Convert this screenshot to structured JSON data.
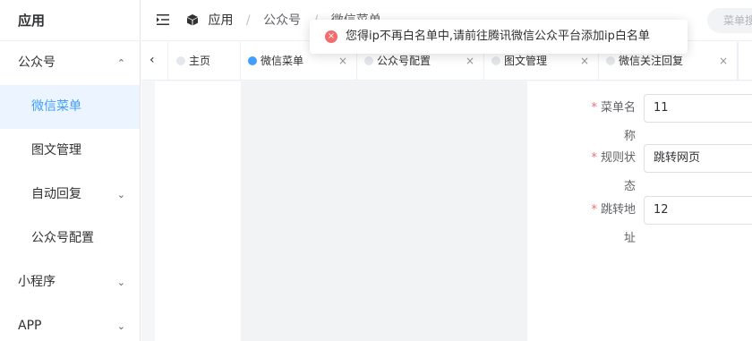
{
  "app": {
    "name": "应用"
  },
  "sidebar": {
    "items": [
      {
        "label": "公众号",
        "has_arrow": true,
        "arrow": "⌃"
      },
      {
        "label": "微信菜单"
      },
      {
        "label": "图文管理"
      },
      {
        "label": "自动回复",
        "has_arrow": true,
        "arrow": "⌄"
      },
      {
        "label": "公众号配置"
      },
      {
        "label": "小程序",
        "has_arrow": true,
        "arrow": "⌄"
      },
      {
        "label": "APP",
        "has_arrow": true,
        "arrow": "⌄"
      }
    ]
  },
  "header": {
    "fold_icon": "menu-fold-icon",
    "breadcrumb": {
      "root": "应用",
      "level1": "公众号",
      "level2": "微信菜单"
    },
    "search": {
      "placeholder": "菜单搜"
    }
  },
  "tabs": {
    "prev_icon": "‹",
    "close_icon": "×",
    "items": [
      {
        "label": "主页",
        "active": false,
        "closable": false
      },
      {
        "label": "微信菜单",
        "active": true,
        "closable": true
      },
      {
        "label": "公众号配置",
        "active": false,
        "closable": true
      },
      {
        "label": "图文管理",
        "active": false,
        "closable": true
      },
      {
        "label": "微信关注回复",
        "active": false,
        "closable": true
      }
    ]
  },
  "form": {
    "required_mark": "*",
    "fields": [
      {
        "label": "菜单名称",
        "value": "11"
      },
      {
        "label": "规则状态",
        "value": "跳转网页"
      },
      {
        "label": "跳转地址",
        "value": "12"
      }
    ]
  },
  "toast": {
    "icon": "error-icon",
    "glyph": "×",
    "message": "您得ip不再白名单中,请前往腾讯微信公众平台添加ip白名单"
  },
  "colors": {
    "accent": "#409eff",
    "active_bg": "#ecf5ff",
    "error": "#f56c6c",
    "required": "#f56c6c"
  }
}
